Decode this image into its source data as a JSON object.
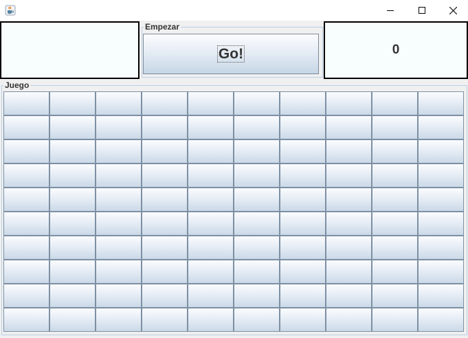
{
  "window": {
    "title": "",
    "icon": "java-cup-icon",
    "controls": [
      "minimize-icon",
      "maximize-icon",
      "close-icon"
    ]
  },
  "status_left": {
    "text": ""
  },
  "empezar": {
    "title": "Empezar",
    "go_label": "Go!"
  },
  "score": {
    "value": "0"
  },
  "juego": {
    "title": "Juego",
    "rows": 10,
    "columns": 10
  },
  "colors": {
    "border": "#000000",
    "button_top": "#fbfcfe",
    "button_bottom": "#c7d6e6",
    "group_border": "#b8cfe5"
  }
}
